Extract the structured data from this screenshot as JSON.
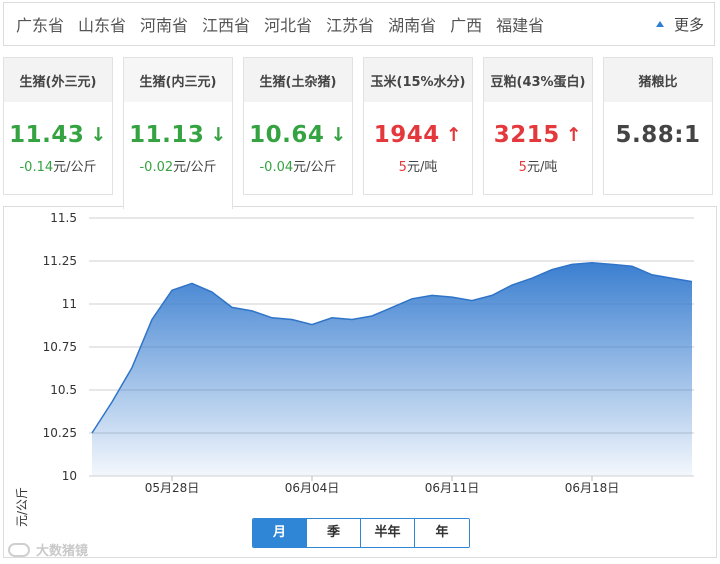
{
  "provinces": [
    "广东省",
    "山东省",
    "河南省",
    "江西省",
    "河北省",
    "江苏省",
    "湖南省",
    "广西",
    "福建省"
  ],
  "more_label": "更多",
  "cards": [
    {
      "title": "生猪(外三元)",
      "value": "11.43",
      "trend": "down",
      "arrow": "↓",
      "change": "-0.14",
      "unit": "元/公斤",
      "active": false
    },
    {
      "title": "生猪(内三元)",
      "value": "11.13",
      "trend": "down",
      "arrow": "↓",
      "change": "-0.02",
      "unit": "元/公斤",
      "active": true
    },
    {
      "title": "生猪(土杂猪)",
      "value": "10.64",
      "trend": "down",
      "arrow": "↓",
      "change": "-0.04",
      "unit": "元/公斤",
      "active": false
    },
    {
      "title": "玉米(15%水分)",
      "value": "1944",
      "trend": "up",
      "arrow": "↑",
      "change": "5",
      "unit": "元/吨",
      "active": false
    },
    {
      "title": "豆粕(43%蛋白)",
      "value": "3215",
      "trend": "up",
      "arrow": "↑",
      "change": "5",
      "unit": "元/吨",
      "active": false
    },
    {
      "title": "猪粮比",
      "value": "5.88:1",
      "trend": "flat",
      "arrow": "",
      "change": "",
      "unit": "",
      "active": false
    }
  ],
  "chart_data": {
    "type": "area",
    "title": "",
    "xlabel": "",
    "ylabel": "元/公斤",
    "ylim": [
      10,
      11.5
    ],
    "yticks": [
      "10",
      "10.25",
      "10.5",
      "10.75",
      "11",
      "11.25",
      "11.5"
    ],
    "xtick_labels": [
      "05月28日",
      "06月04日",
      "06月11日",
      "06月18日"
    ],
    "grid": true,
    "color": "#3b7fd0",
    "x": [
      "05月24日",
      "05月25日",
      "05月26日",
      "05月27日",
      "05月28日",
      "05月29日",
      "05月30日",
      "05月31日",
      "06月01日",
      "06月02日",
      "06月03日",
      "06月04日",
      "06月05日",
      "06月06日",
      "06月07日",
      "06月08日",
      "06月09日",
      "06月10日",
      "06月11日",
      "06月12日",
      "06月13日",
      "06月14日",
      "06月15日",
      "06月16日",
      "06月17日",
      "06月18日",
      "06月19日",
      "06月20日",
      "06月21日",
      "06月22日",
      "06月23日"
    ],
    "values": [
      10.25,
      10.43,
      10.63,
      10.91,
      11.08,
      11.12,
      11.07,
      10.98,
      10.96,
      10.92,
      10.91,
      10.88,
      10.92,
      10.91,
      10.93,
      10.98,
      11.03,
      11.05,
      11.04,
      11.02,
      11.05,
      11.11,
      11.15,
      11.2,
      11.23,
      11.24,
      11.23,
      11.22,
      11.17,
      11.15,
      11.13
    ]
  },
  "period_tabs": [
    {
      "label": "月",
      "active": true
    },
    {
      "label": "季",
      "active": false
    },
    {
      "label": "半年",
      "active": false
    },
    {
      "label": "年",
      "active": false
    }
  ],
  "watermark": "大数猪镜"
}
